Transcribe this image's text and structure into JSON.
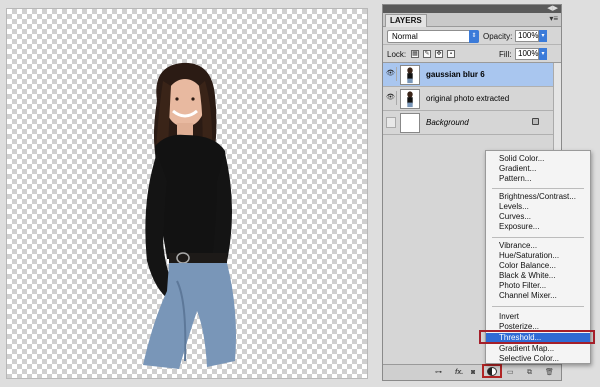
{
  "canvas": {
    "subject": "woman cut-out on transparent background"
  },
  "panel": {
    "tab_label": "LAYERS",
    "menu_icon": "panel-menu-icon",
    "blend_mode": "Normal",
    "opacity_label": "Opacity:",
    "opacity_value": "100%",
    "lock_label": "Lock:",
    "fill_label": "Fill:",
    "fill_value": "100%",
    "layers": [
      {
        "name": "gaussian blur 6",
        "selected": true,
        "visible": true
      },
      {
        "name": "original photo extracted",
        "selected": false,
        "visible": true
      },
      {
        "name": "Background",
        "selected": false,
        "visible": false,
        "locked": true
      }
    ],
    "bottom_icons": [
      "link-icon",
      "fx-icon",
      "mask-icon",
      "adjustment-icon",
      "group-icon",
      "new-layer-icon",
      "trash-icon"
    ],
    "fx_label": "fx."
  },
  "adjustment_menu": {
    "groups": [
      [
        "Solid Color...",
        "Gradient...",
        "Pattern..."
      ],
      [
        "Brightness/Contrast...",
        "Levels...",
        "Curves...",
        "Exposure..."
      ],
      [
        "Vibrance...",
        "Hue/Saturation...",
        "Color Balance...",
        "Black & White...",
        "Photo Filter...",
        "Channel Mixer..."
      ],
      [
        "Invert",
        "Posterize...",
        "Threshold...",
        "Gradient Map...",
        "Selective Color..."
      ]
    ],
    "active_item": "Threshold..."
  },
  "colors": {
    "selection": "#2f6bd5",
    "highlight_box": "#a51f2a",
    "layer_selected": "#a9c6ef"
  }
}
